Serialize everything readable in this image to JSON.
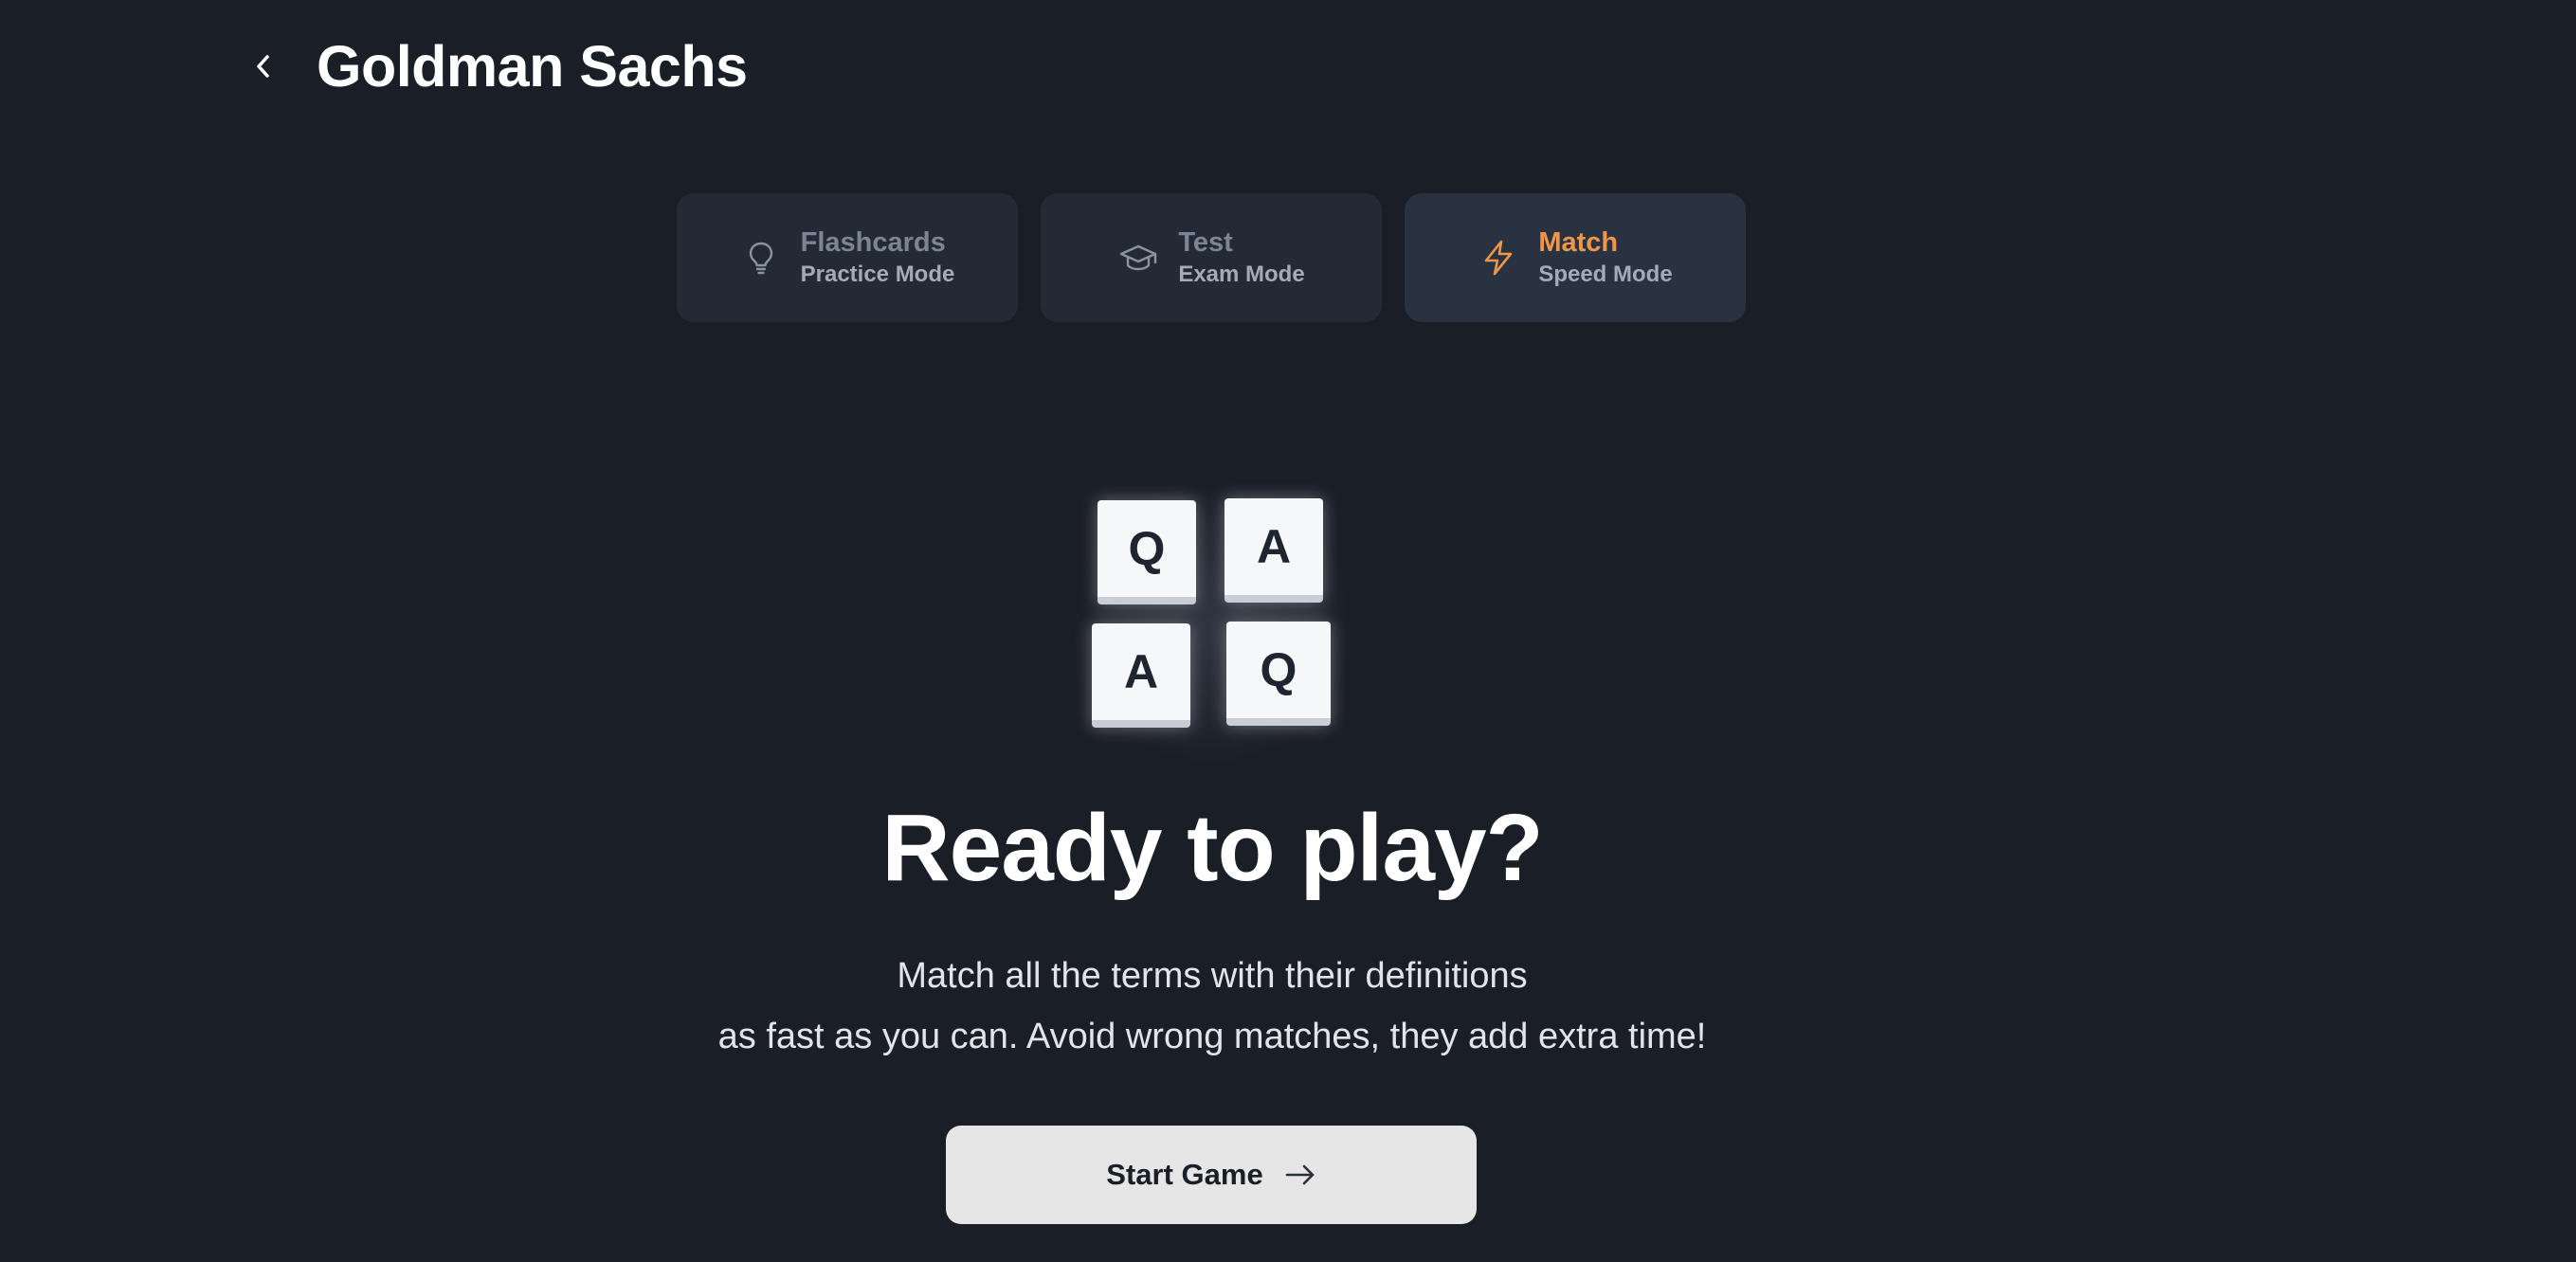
{
  "header": {
    "title": "Goldman Sachs",
    "back_icon": "chevron-left-icon"
  },
  "modes": [
    {
      "name": "Flashcards",
      "subtitle": "Practice Mode",
      "icon": "lightbulb-icon",
      "active": false
    },
    {
      "name": "Test",
      "subtitle": "Exam Mode",
      "icon": "graduation-cap-icon",
      "active": false
    },
    {
      "name": "Match",
      "subtitle": "Speed Mode",
      "icon": "lightning-bolt-icon",
      "active": true
    }
  ],
  "illustration": {
    "tiles": [
      "Q",
      "A",
      "A",
      "Q"
    ]
  },
  "main": {
    "headline": "Ready to play?",
    "description_line1": "Match all the terms with their definitions",
    "description_line2": "as fast as you can. Avoid wrong matches, they add extra time!"
  },
  "start_button": {
    "label": "Start Game",
    "icon": "arrow-right-icon"
  },
  "colors": {
    "background": "#1a1e27",
    "card": "#232a35",
    "active_card": "#283241",
    "accent": "#f0964a",
    "button": "#e6e6e6"
  }
}
